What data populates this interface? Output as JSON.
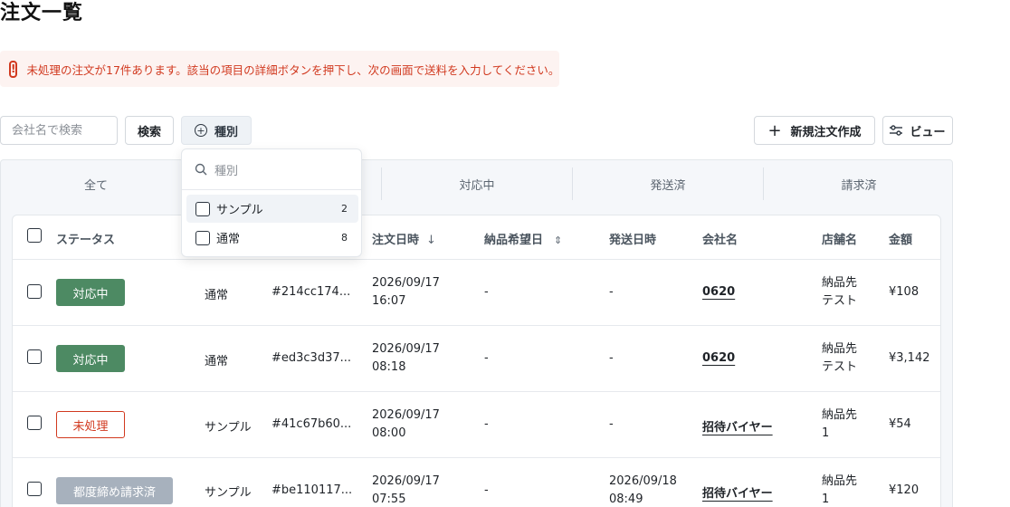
{
  "page": {
    "title": "注文一覧"
  },
  "alert": {
    "icon": "alert-icon",
    "text": "未処理の注文が17件あります。該当の項目の詳細ボタンを押下し、次の画面で送料を入力してください。"
  },
  "toolbar": {
    "search_placeholder": "会社名で検索",
    "search_label": "検索",
    "type_filter_label": "種別",
    "new_order_label": "新規注文作成",
    "view_label": "ビュー"
  },
  "tabs": [
    {
      "label": "全て"
    },
    {
      "label": ""
    },
    {
      "label": "対応中"
    },
    {
      "label": "発送済"
    },
    {
      "label": "請求済"
    }
  ],
  "table": {
    "headers": {
      "status": "ステータス",
      "order_date": "注文日時",
      "delivery_date": "納品希望日",
      "ship_date": "発送日時",
      "company": "会社名",
      "store": "店舗名",
      "amount": "金額"
    },
    "rows": [
      {
        "status": "対応中",
        "status_style": "green",
        "type": "通常",
        "id": "#214cc174...",
        "order_date": "2026/09/17",
        "order_time": "16:07",
        "delivery": "-",
        "ship_date": "-",
        "ship_time": "",
        "company": "0620",
        "store_1": "納品先",
        "store_2": "テスト",
        "amount": "¥108"
      },
      {
        "status": "対応中",
        "status_style": "green",
        "type": "通常",
        "id": "#ed3c3d37...",
        "order_date": "2026/09/17",
        "order_time": "08:18",
        "delivery": "-",
        "ship_date": "-",
        "ship_time": "",
        "company": "0620",
        "store_1": "納品先",
        "store_2": "テスト",
        "amount": "¥3,142"
      },
      {
        "status": "未処理",
        "status_style": "outline",
        "type": "サンプル",
        "id": "#41c67b60...",
        "order_date": "2026/09/17",
        "order_time": "08:00",
        "delivery": "-",
        "ship_date": "-",
        "ship_time": "",
        "company": "招待バイヤー",
        "store_1": "納品先",
        "store_2": "1",
        "amount": "¥54"
      },
      {
        "status": "都度締め請求済",
        "status_style": "gray",
        "type": "サンプル",
        "id": "#be110117...",
        "order_date": "2026/09/17",
        "order_time": "07:55",
        "delivery": "-",
        "ship_date": "2026/09/18",
        "ship_time": "08:49",
        "company": "招待バイヤー",
        "store_1": "納品先",
        "store_2": "1",
        "amount": "¥120"
      }
    ]
  },
  "type_dropdown": {
    "search_placeholder": "種別",
    "options": [
      {
        "label": "サンプル",
        "count": "2"
      },
      {
        "label": "通常",
        "count": "8"
      }
    ]
  },
  "colors": {
    "accent_green": "#4d8a63",
    "alert_red": "#d1391f",
    "muted_gray": "#a7b1bd"
  }
}
